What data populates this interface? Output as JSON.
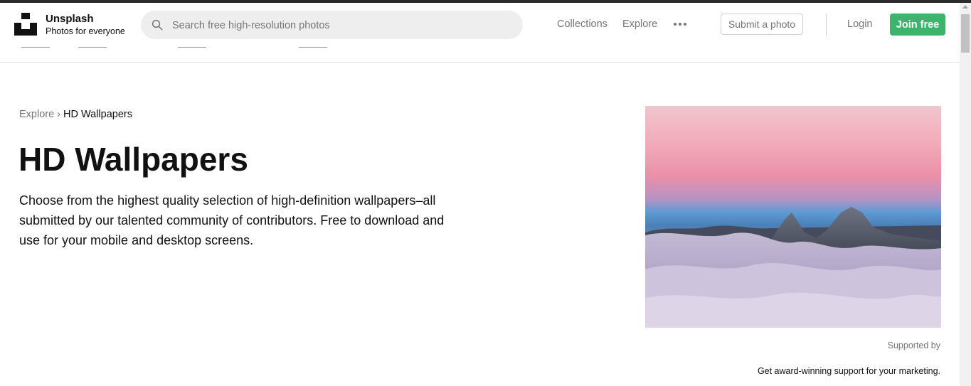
{
  "brand": {
    "name": "Unsplash",
    "tagline": "Photos for everyone",
    "icon": "unsplash-logo"
  },
  "search": {
    "placeholder": "Search free high-resolution photos",
    "value": "",
    "icon": "search-icon"
  },
  "nav": {
    "collections": "Collections",
    "explore": "Explore",
    "more_icon": "more-dots-icon",
    "submit_photo": "Submit a photo",
    "login": "Login",
    "join": "Join free"
  },
  "breadcrumb": {
    "parent": "Explore",
    "separator": "›",
    "current": "HD Wallpapers"
  },
  "page": {
    "title": "HD Wallpapers",
    "description": "Choose from the highest quality selection of high-definition wallpapers–all submitted by our talented community of contributors. Free to download and use for your mobile and desktop screens."
  },
  "sponsor": {
    "label": "Supported by",
    "text": "Get award-winning support for your marketing."
  },
  "colors": {
    "join_button": "#3cb46e",
    "muted_text": "#767676",
    "search_bg": "#eeeeee"
  }
}
